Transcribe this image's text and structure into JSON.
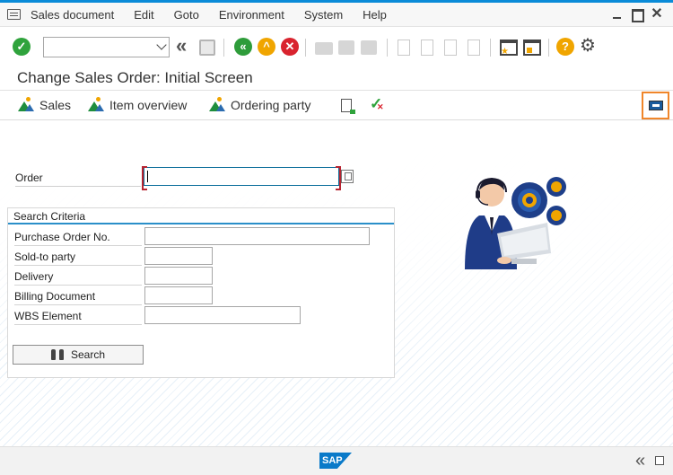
{
  "menu": {
    "items": [
      "Sales document",
      "Edit",
      "Goto",
      "Environment",
      "System",
      "Help"
    ]
  },
  "window": {
    "minimize": "",
    "maximize": "",
    "close": "✕"
  },
  "toolbar": {
    "command_field_value": "",
    "icons": [
      "enter-icon",
      "command-field",
      "collapse-icon",
      "save-icon",
      "back-icon",
      "exit-icon",
      "cancel-icon",
      "print-icon",
      "find-icon",
      "find-next-icon",
      "first-page-icon",
      "previous-page-icon",
      "next-page-icon",
      "last-page-icon",
      "new-session-icon",
      "shortcut-icon",
      "help-icon",
      "settings-icon"
    ]
  },
  "title": "Change Sales Order: Initial Screen",
  "app_toolbar": {
    "sales": "Sales",
    "item_overview": "Item overview",
    "ordering_party": "Ordering party"
  },
  "form": {
    "order_label": "Order",
    "order_value": "",
    "search_criteria_title": "Search Criteria",
    "fields": [
      {
        "label": "Purchase Order No.",
        "value": ""
      },
      {
        "label": "Sold-to party",
        "value": ""
      },
      {
        "label": "Delivery",
        "value": ""
      },
      {
        "label": "Billing Document",
        "value": ""
      },
      {
        "label": "WBS Element",
        "value": ""
      }
    ],
    "search_button": "Search"
  },
  "footer": {
    "logo": "SAP"
  },
  "colors": {
    "accent": "#0a8bd8",
    "green": "#2fa33c",
    "orange": "#f0a500",
    "red": "#d9232e",
    "highlight": "#f0862a"
  }
}
